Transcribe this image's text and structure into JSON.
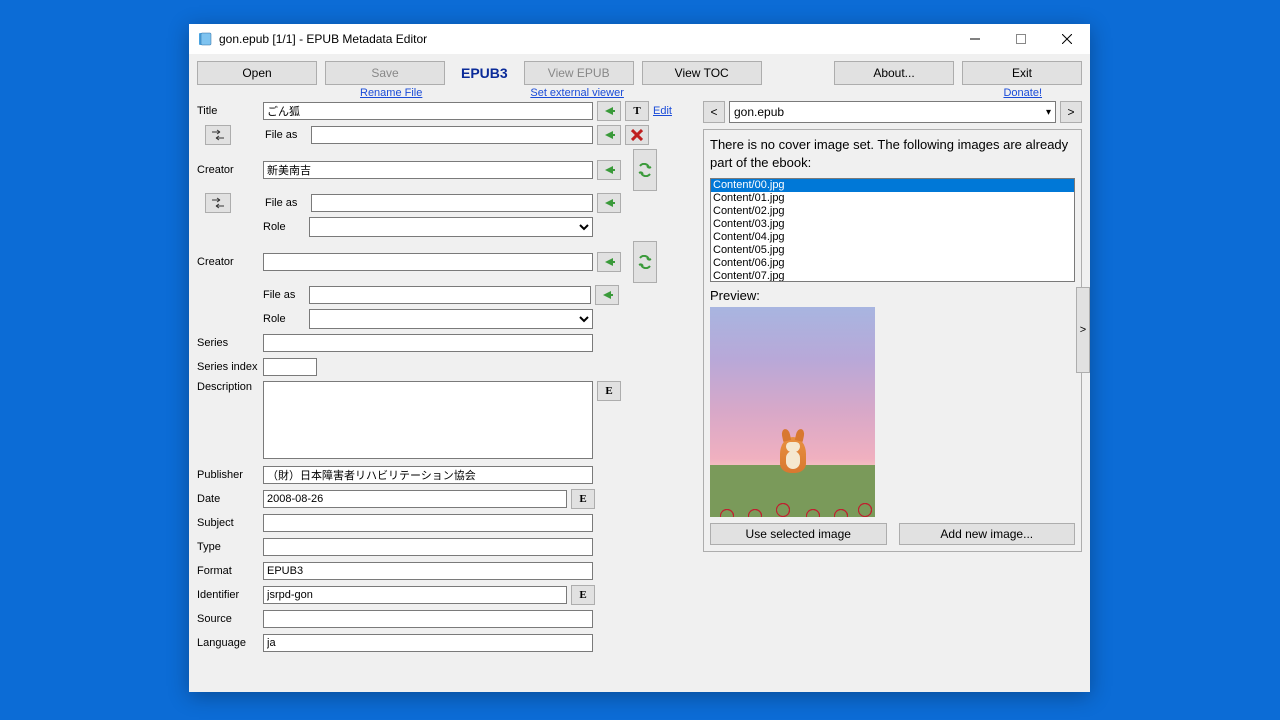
{
  "window": {
    "title": "gon.epub [1/1] - EPUB Metadata Editor"
  },
  "toolbar": {
    "open": "Open",
    "save": "Save",
    "epub3": "EPUB3",
    "view_epub": "View EPUB",
    "view_toc": "View TOC",
    "about": "About...",
    "exit": "Exit"
  },
  "links": {
    "rename": "Rename File",
    "set_viewer": "Set external viewer",
    "donate": "Donate!"
  },
  "labels": {
    "title": "Title",
    "file_as": "File as",
    "creator": "Creator",
    "role": "Role",
    "series": "Series",
    "series_index": "Series index",
    "description": "Description",
    "publisher": "Publisher",
    "date": "Date",
    "subject": "Subject",
    "type": "Type",
    "format": "Format",
    "identifier": "Identifier",
    "source": "Source",
    "language": "Language",
    "edit": "Edit"
  },
  "fields": {
    "title": "ごん狐",
    "title_fileas": "",
    "creator1": "新美南吉",
    "creator1_fileas": "",
    "creator1_role": "",
    "creator2": "",
    "creator2_fileas": "",
    "creator2_role": "",
    "series": "",
    "series_index": "",
    "description": "",
    "publisher": "（財）日本障害者リハビリテーション協会",
    "date": "2008-08-26",
    "subject": "",
    "type": "",
    "format": "EPUB3",
    "identifier": "jsrpd-gon",
    "source": "",
    "language": "ja"
  },
  "right": {
    "prev": "<",
    "next": ">",
    "file": "gon.epub",
    "cover_msg": "There is no cover image set.  The following images are already part of the ebook:",
    "images": [
      "Content/00.jpg",
      "Content/01.jpg",
      "Content/02.jpg",
      "Content/03.jpg",
      "Content/04.jpg",
      "Content/05.jpg",
      "Content/06.jpg",
      "Content/07.jpg"
    ],
    "preview": "Preview:",
    "use_selected": "Use selected image",
    "add_new": "Add new image...",
    "expand": ">"
  },
  "icons": {
    "T": "T",
    "E": "E"
  }
}
